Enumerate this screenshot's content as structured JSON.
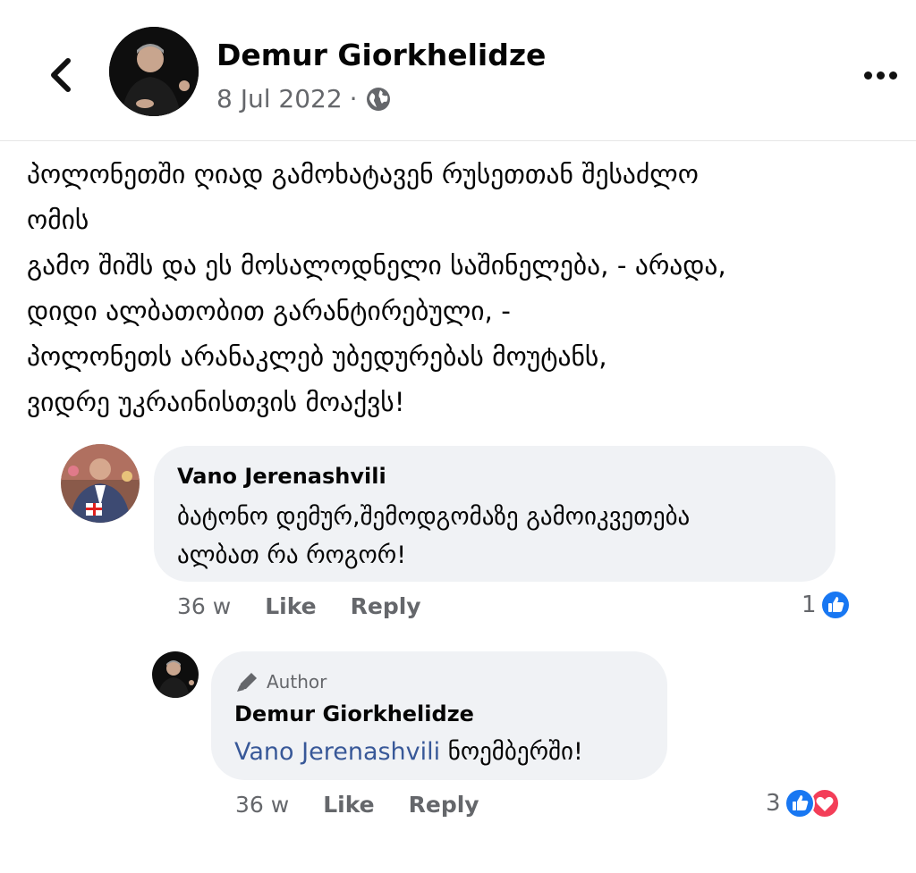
{
  "post": {
    "author": "Demur Giorkhelidze",
    "date": "8 Jul 2022",
    "separator": "·",
    "privacy_icon": "globe-icon",
    "lines": [
      "პოლონეთში ღიად გამოხატავენ რუსეთთან შესაძლო",
      "ომის",
      "გამო შიშს და ეს მოსალოდნელი საშინელება, - არადა,",
      "დიდი ალბათობით გარანტირებული, -",
      "პოლონეთს არანაკლებ უბედურებას მოუტანს,",
      "ვიდრე უკრაინისთვის მოაქვს!"
    ]
  },
  "comments": [
    {
      "author": "Vano Jerenashvili",
      "lines": [
        "ბატონო დემურ,შემოდგომაზე გამოიკვეთება",
        "ალბათ რა როგორ!"
      ],
      "time": "36 w",
      "like_label": "Like",
      "reply_label": "Reply",
      "reaction_count": "1"
    }
  ],
  "reply": {
    "badge": "Author",
    "author": "Demur Giorkhelidze",
    "mention": "Vano Jerenashvili",
    "text": " ნოემბერში!",
    "time": "36 w",
    "like_label": "Like",
    "reply_label": "Reply",
    "reaction_count": "3"
  },
  "colors": {
    "like_blue": "#1877f2",
    "love_red": "#f33e58",
    "mention": "#385898",
    "bubble": "#f0f2f5"
  }
}
